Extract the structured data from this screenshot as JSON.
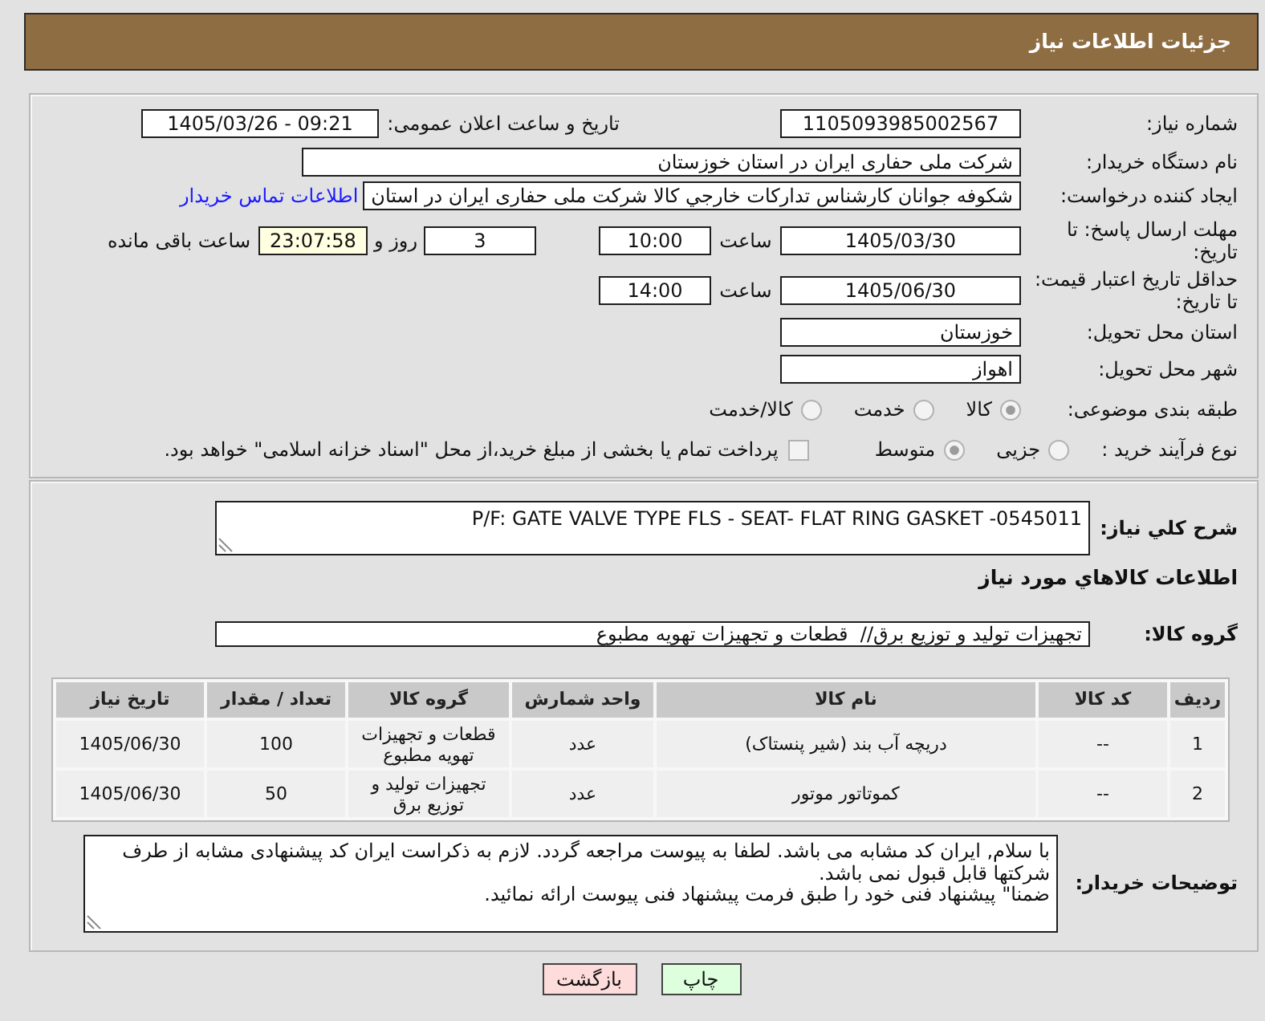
{
  "header": {
    "title": "جزئیات اطلاعات نیاز"
  },
  "need_number": {
    "label": "شماره نیاز:",
    "value": "1105093985002567"
  },
  "announcement": {
    "label": "تاریخ و ساعت اعلان عمومی:",
    "value": "1405/03/26 - 09:21"
  },
  "buyer_organization": {
    "label": "نام دستگاه خریدار:",
    "value": "شرکت ملی حفاری ایران در استان خوزستان"
  },
  "requester": {
    "label": "ایجاد کننده درخواست:",
    "value": "شکوفه جوانان کارشناس تدارکات خارجي کالا شرکت ملی حفاری ایران در استان",
    "link": "اطلاعات تماس خریدار"
  },
  "response_deadline": {
    "label": "مهلت ارسال پاسخ: تا تاریخ:",
    "date": "1405/03/30",
    "time_label": "ساعت",
    "time": "10:00",
    "days": "3",
    "days_label": "روز و",
    "remaining": "23:07:58",
    "remaining_label": "ساعت باقی مانده"
  },
  "price_validity": {
    "label": "حداقل تاریخ اعتبار قیمت: تا تاریخ:",
    "date": "1405/06/30",
    "time_label": "ساعت",
    "time": "14:00"
  },
  "delivery_province": {
    "label": "استان محل تحویل:",
    "value": "خوزستان"
  },
  "delivery_city": {
    "label": "شهر محل تحویل:",
    "value": "اهواز"
  },
  "subject_category": {
    "label": "طبقه بندی موضوعی:",
    "options": [
      {
        "label": "کالا",
        "selected": true
      },
      {
        "label": "خدمت",
        "selected": false
      },
      {
        "label": "کالا/خدمت",
        "selected": false
      }
    ]
  },
  "purchase_process": {
    "label": "نوع فرآیند خرید :",
    "options": [
      {
        "label": "جزیی",
        "selected": false
      },
      {
        "label": "متوسط",
        "selected": true
      }
    ],
    "treasury_payment": {
      "label": "پرداخت تمام یا بخشی از مبلغ خرید،از محل \"اسناد خزانه اسلامی\" خواهد بود.",
      "checked": false
    }
  },
  "general_description": {
    "label": "شرح کلي نیاز:",
    "value": "P/F: GATE VALVE TYPE FLS - SEAT- FLAT RING GASKET -0545011"
  },
  "items_section": {
    "title": "اطلاعات کالاهاي مورد نیاز"
  },
  "goods_group": {
    "label": "گروه کالا:",
    "value": "تجهیزات تولید و توزیع برق//  قطعات و تجهیزات تهویه مطبوع"
  },
  "items_table": {
    "columns": [
      "ردیف",
      "کد کالا",
      "نام کالا",
      "واحد شمارش",
      "گروه کالا",
      "تعداد / مقدار",
      "تاریخ نیاز"
    ],
    "rows": [
      [
        "1",
        "--",
        "دریچه آب بند (شیر پنستاک)",
        "عدد",
        "قطعات و تجهیزات تهویه مطبوع",
        "100",
        "1405/06/30"
      ],
      [
        "2",
        "--",
        "کموتاتور موتور",
        "عدد",
        "تجهیزات تولید و توزیع برق",
        "50",
        "1405/06/30"
      ]
    ]
  },
  "buyer_notes": {
    "label": "توضیحات خریدار:",
    "value": "با سلام, ایران کد مشابه می باشد. لطفا به پیوست مراجعه گردد. لازم به ذکراست ایران کد پیشنهادی مشابه از طرف شرکتها قابل قبول نمی باشد.\nضمنا\" پیشنهاد فنی خود را طبق فرمت پیشنهاد فنی پیوست ارائه نمائید."
  },
  "buttons": [
    {
      "kind": "print",
      "label": "چاپ"
    },
    {
      "kind": "back",
      "label": "بازگشت"
    }
  ]
}
